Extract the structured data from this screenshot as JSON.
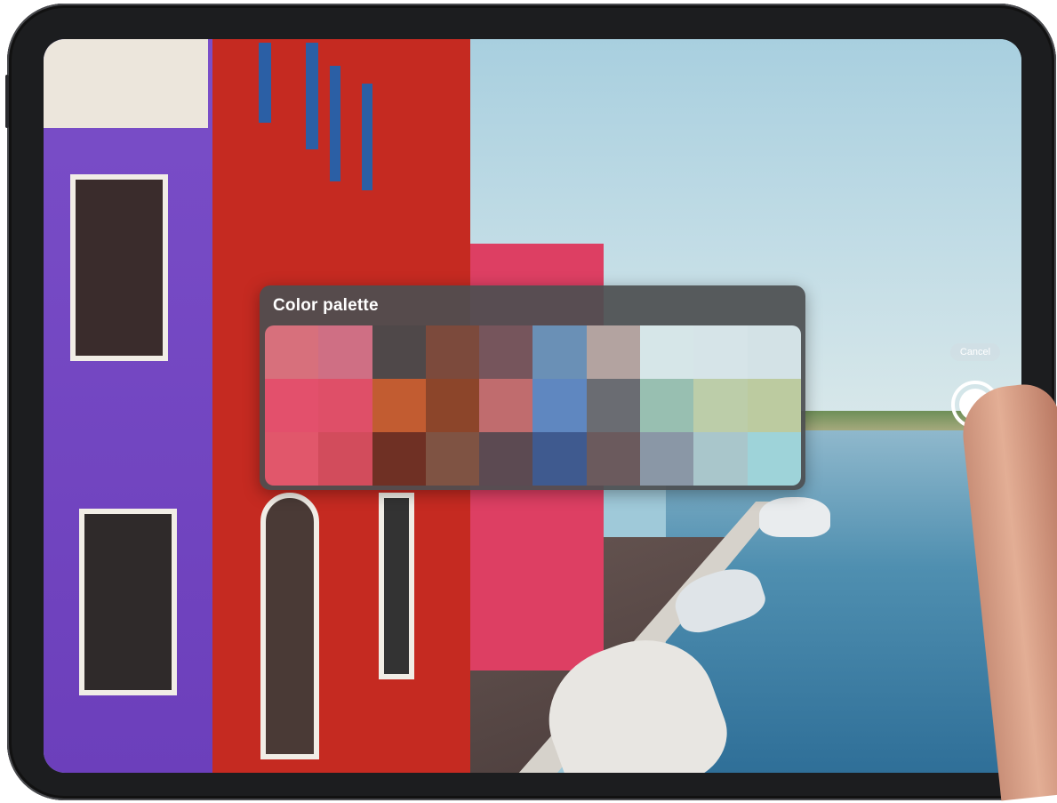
{
  "palette": {
    "title": "Color palette",
    "swatches": [
      [
        "#d7707c",
        "#cf6f84",
        "#4f4849",
        "#7c4a3c",
        "#76555c",
        "#6a90b6",
        "#b3a3a0",
        "#d6e6e8",
        "#d6e4e8",
        "#d3e2e6"
      ],
      [
        "#e3506c",
        "#df4f68",
        "#c25c31",
        "#8c452a",
        "#c06c6e",
        "#5f87c0",
        "#6a6c72",
        "#98bfb1",
        "#bccda9",
        "#bccba0"
      ],
      [
        "#e1576b",
        "#d24c5c",
        "#6f3024",
        "#7f5343",
        "#5c4a52",
        "#3f5a8f",
        "#6b5a5d",
        "#8a97a6",
        "#a9c6cb",
        "#9ed3d9"
      ]
    ]
  },
  "camera": {
    "cancel_label": "Cancel"
  }
}
